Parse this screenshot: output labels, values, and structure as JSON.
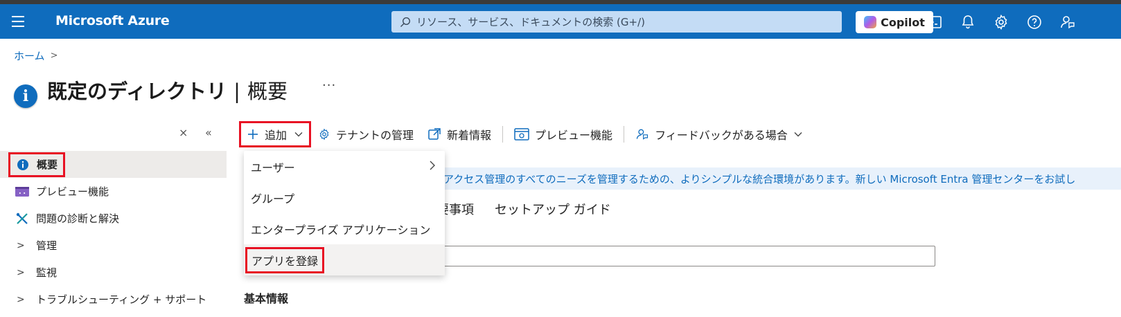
{
  "header": {
    "brand": "Microsoft Azure",
    "search_placeholder": "リソース、サービス、ドキュメントの検索 (G+/)",
    "copilot_label": "Copilot"
  },
  "breadcrumb": {
    "home": "ホーム"
  },
  "page": {
    "title_main": "既定のディレクトリ",
    "title_sep": "|",
    "title_sub": "概要",
    "more": "..."
  },
  "sidebar": {
    "items": [
      {
        "label": "概要",
        "icon": "info-icon"
      },
      {
        "label": "プレビュー機能",
        "icon": "preview-icon"
      },
      {
        "label": "問題の診断と解決",
        "icon": "tools-icon"
      },
      {
        "label": "管理",
        "icon": "chevron-right-icon"
      },
      {
        "label": "監視",
        "icon": "chevron-right-icon"
      },
      {
        "label": "トラブルシューティング + サポート",
        "icon": "chevron-right-icon"
      }
    ]
  },
  "toolbar": {
    "add": "追加",
    "tenant": "テナントの管理",
    "whatsnew": "新着情報",
    "preview": "プレビュー機能",
    "feedback": "フィードバックがある場合"
  },
  "dropdown": {
    "items": [
      "ユーザー",
      "グループ",
      "エンタープライズ アプリケーション",
      "アプリを登録"
    ]
  },
  "banner": {
    "text": "アクセス管理のすべてのニーズを管理するための、よりシンプルな統合環境があります。新しい Microsoft Entra 管理センターをお試し"
  },
  "tabs": {
    "items": [
      "要事項",
      "セットアップ ガイド"
    ]
  },
  "section": {
    "basic_info": "基本情報"
  },
  "colors": {
    "azure_blue": "#0f6cbd",
    "highlight_red": "#e81123"
  }
}
